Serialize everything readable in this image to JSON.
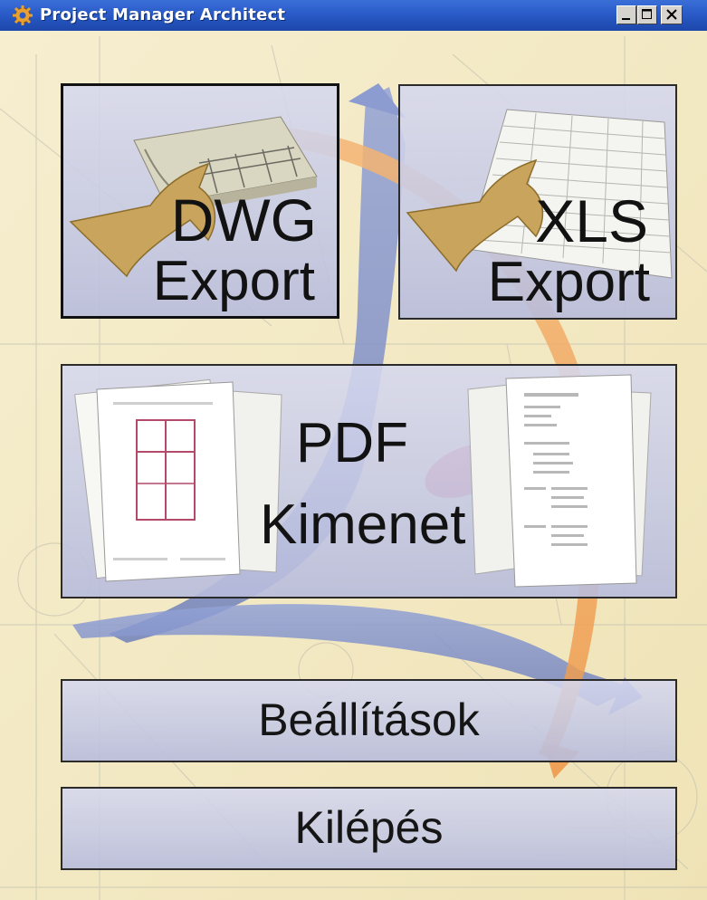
{
  "window": {
    "title": "Project Manager Architect",
    "controls": {
      "minimize": "minimize",
      "maximize": "maximize",
      "close": "close"
    }
  },
  "tiles": {
    "dwg": {
      "line1": "DWG",
      "line2": "Export"
    },
    "xls": {
      "line1": "XLS",
      "line2": "Export"
    },
    "pdf": {
      "line1": "PDF",
      "line2": "Kimenet"
    }
  },
  "buttons": {
    "settings": "Beállítások",
    "exit": "Kilépés"
  },
  "colors": {
    "titlebar": "#2a5bc8",
    "background": "#f3ebc6",
    "panel": "#c8cbe5",
    "swoosh_blue": "#7f8fc4",
    "swoosh_orange": "#f0a45a",
    "accent_red": "#e05060",
    "arrow_gold": "#c9a45c"
  }
}
